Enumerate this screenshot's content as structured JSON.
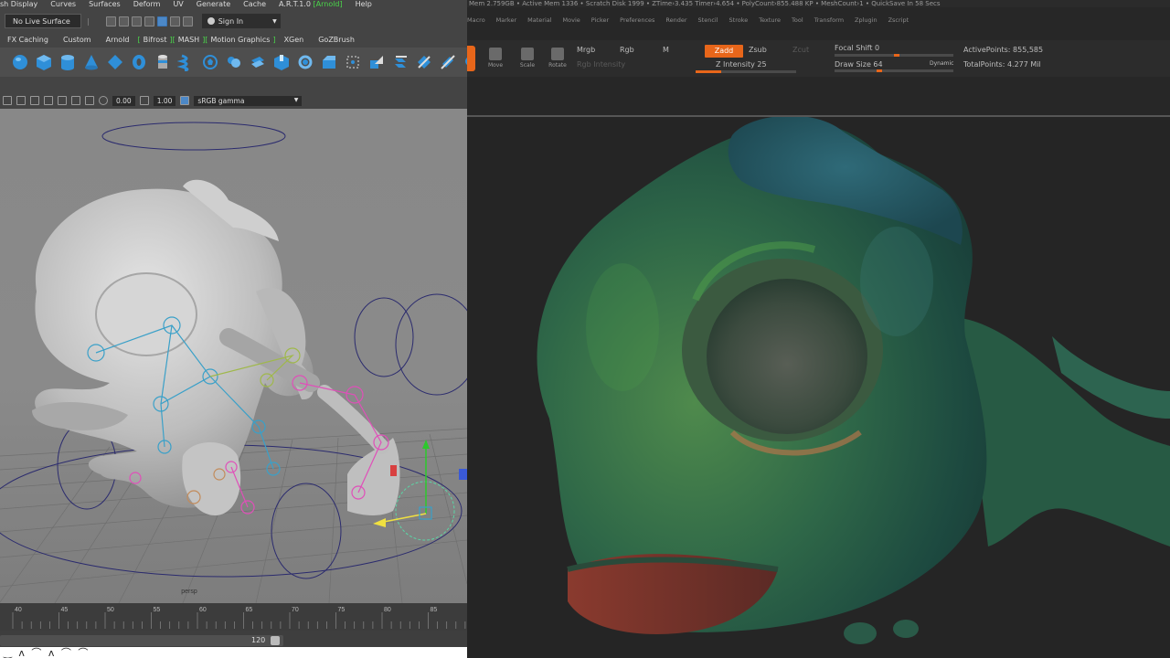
{
  "maya": {
    "menu": [
      "sh Display",
      "Curves",
      "Surfaces",
      "Deform",
      "UV",
      "Generate",
      "Cache",
      "A.R.T.1.0",
      "[Arnold]",
      "Help"
    ],
    "status": {
      "live_surface": "No Live Surface",
      "sign_in": "Sign In"
    },
    "shelf_tabs": [
      "FX Caching",
      "Custom",
      "Arnold",
      "Bifrost",
      "MASH",
      "Motion Graphics",
      "XGen",
      "GoZBrush"
    ],
    "shelf_icons": [
      "sphere-icon",
      "cube-icon",
      "cylinder-icon",
      "cone-icon",
      "plane-icon",
      "torus-icon",
      "pipe-icon",
      "helix-icon",
      "soccer-ball-icon",
      "combine-icon",
      "separate-icon",
      "extrude-icon",
      "bridge-icon",
      "bevel-icon",
      "multi-cut-icon",
      "target-weld-icon",
      "insert-loop-icon",
      "mirror-icon",
      "smooth-icon",
      "sculpt-icon"
    ],
    "panel": {
      "exposure": "0.00",
      "gamma": "1.00",
      "view_transform": "sRGB gamma"
    },
    "viewport": {
      "camera": "persp"
    },
    "timeline": {
      "ticks": [
        "40",
        "45",
        "50",
        "55",
        "60",
        "65",
        "70",
        "75",
        "80",
        "85"
      ],
      "range_end": "120"
    },
    "caption": "‿ ʌ ⌒ ʌ ⌒ ⌒"
  },
  "zbrush": {
    "status": "Mem 2.759GB • Active Mem 1336 • Scratch Disk 1999 • ZTime›3.435 Timer›4.654 • PolyCount›855.488 KP • MeshCount›1 • QuickSave In 58 Secs",
    "menu": [
      "Macro",
      "Marker",
      "Material",
      "Movie",
      "Picker",
      "Preferences",
      "Render",
      "Stencil",
      "Stroke",
      "Texture",
      "Tool",
      "Transform",
      "Zplugin",
      "Zscript"
    ],
    "tools": {
      "move": "Move",
      "scale": "Scale",
      "rotate": "Rotate",
      "mrgb": "Mrgb",
      "rgb": "Rgb",
      "m": "M",
      "rgb_intensity": "Rgb Intensity",
      "zadd": "Zadd",
      "zsub": "Zsub",
      "zcut": "Zcut",
      "z_intensity": "Z Intensity 25",
      "focal_shift": "Focal Shift 0",
      "draw_size": "Draw Size 64",
      "dynamic": "Dynamic"
    },
    "sliders": {
      "z_intensity": 0.25,
      "focal_shift": 0.5,
      "draw_size": 0.35
    },
    "stats": {
      "active_points": "ActivePoints: 855,585",
      "total_points": "TotalPoints: 4.277 Mil"
    },
    "accent_color": "#e8661a"
  }
}
